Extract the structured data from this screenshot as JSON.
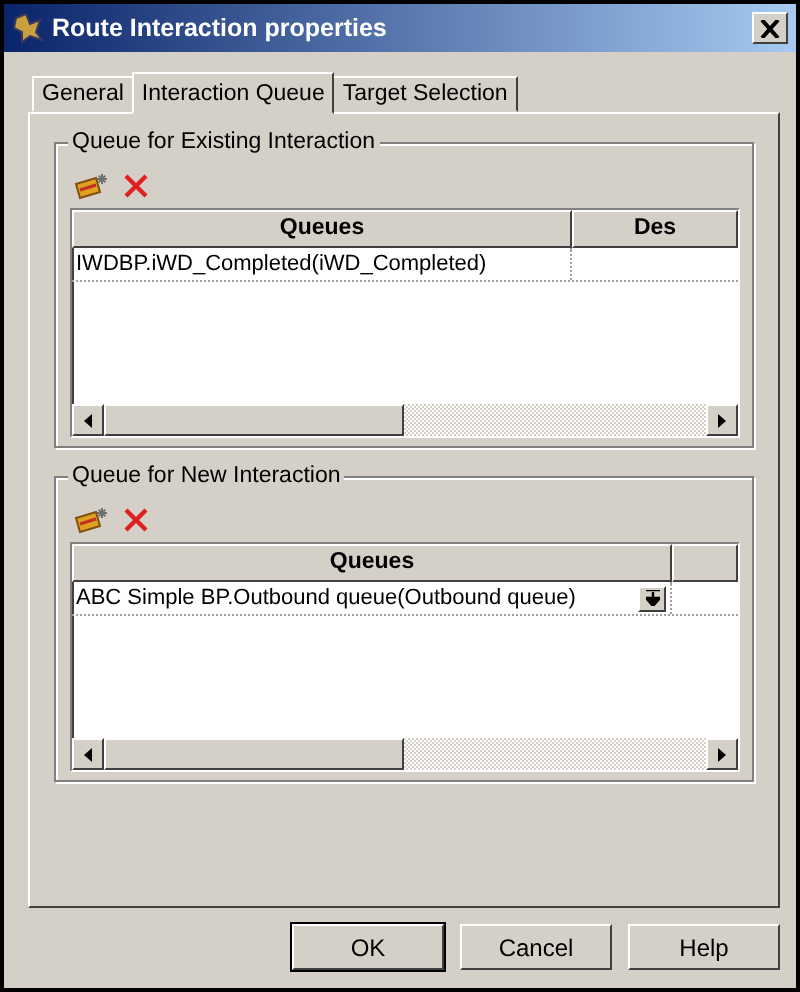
{
  "window": {
    "title": "Route Interaction properties"
  },
  "tabs": [
    {
      "label": "General",
      "selected": false
    },
    {
      "label": "Interaction Queue",
      "selected": true
    },
    {
      "label": "Target Selection",
      "selected": false
    }
  ],
  "groups": [
    {
      "title": "Queue for Existing Interaction",
      "columns": [
        "Queues",
        "Des"
      ],
      "rows": [
        {
          "cells": [
            "IWDBP.iWD_Completed(iWD_Completed)"
          ],
          "dropdown": false
        }
      ]
    },
    {
      "title": "Queue for New Interaction",
      "columns": [
        "Queues"
      ],
      "rows": [
        {
          "cells": [
            "ABC Simple BP.Outbound queue(Outbound queue)"
          ],
          "dropdown": true
        }
      ]
    }
  ],
  "buttons": [
    "OK",
    "Cancel",
    "Help"
  ]
}
